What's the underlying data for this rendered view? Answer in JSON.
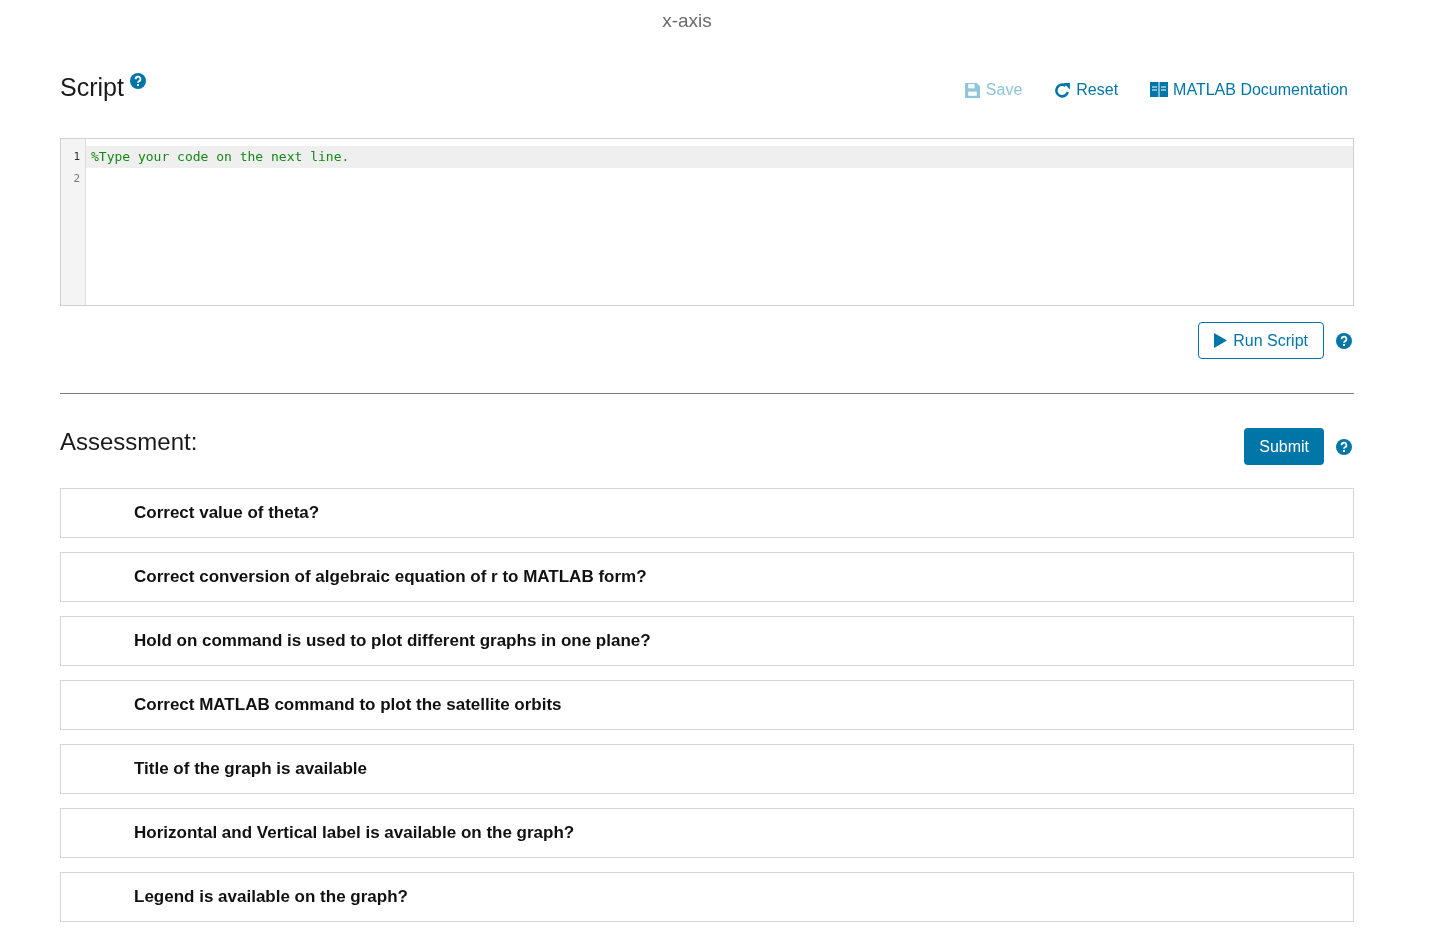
{
  "axis_caption": "x-axis",
  "script": {
    "title": "Script",
    "toolbar": [
      {
        "kind": "save",
        "label": "Save",
        "disabled": true
      },
      {
        "kind": "reset",
        "label": "Reset",
        "disabled": false
      },
      {
        "kind": "docs",
        "label": "MATLAB Documentation",
        "disabled": false
      }
    ],
    "editor": {
      "lines": [
        {
          "number": "1",
          "code": "%Type your code on the next line.",
          "selected": true
        },
        {
          "number": "2",
          "selected": false
        }
      ]
    },
    "run_button": "Run Script"
  },
  "assessment": {
    "title": "Assessment:",
    "submit_button": "Submit",
    "items": [
      {
        "label": "Correct value of theta?"
      },
      {
        "label": "Correct conversion of algebraic equation of r to MATLAB form?"
      },
      {
        "label": "Hold on command is used to plot different graphs in one plane?"
      },
      {
        "label": "Correct MATLAB command to plot the satellite orbits"
      },
      {
        "label": "Title of the graph is available"
      },
      {
        "label": "Horizontal and Vertical label is available on the graph?"
      },
      {
        "label": "Legend is available on the graph?"
      }
    ]
  }
}
